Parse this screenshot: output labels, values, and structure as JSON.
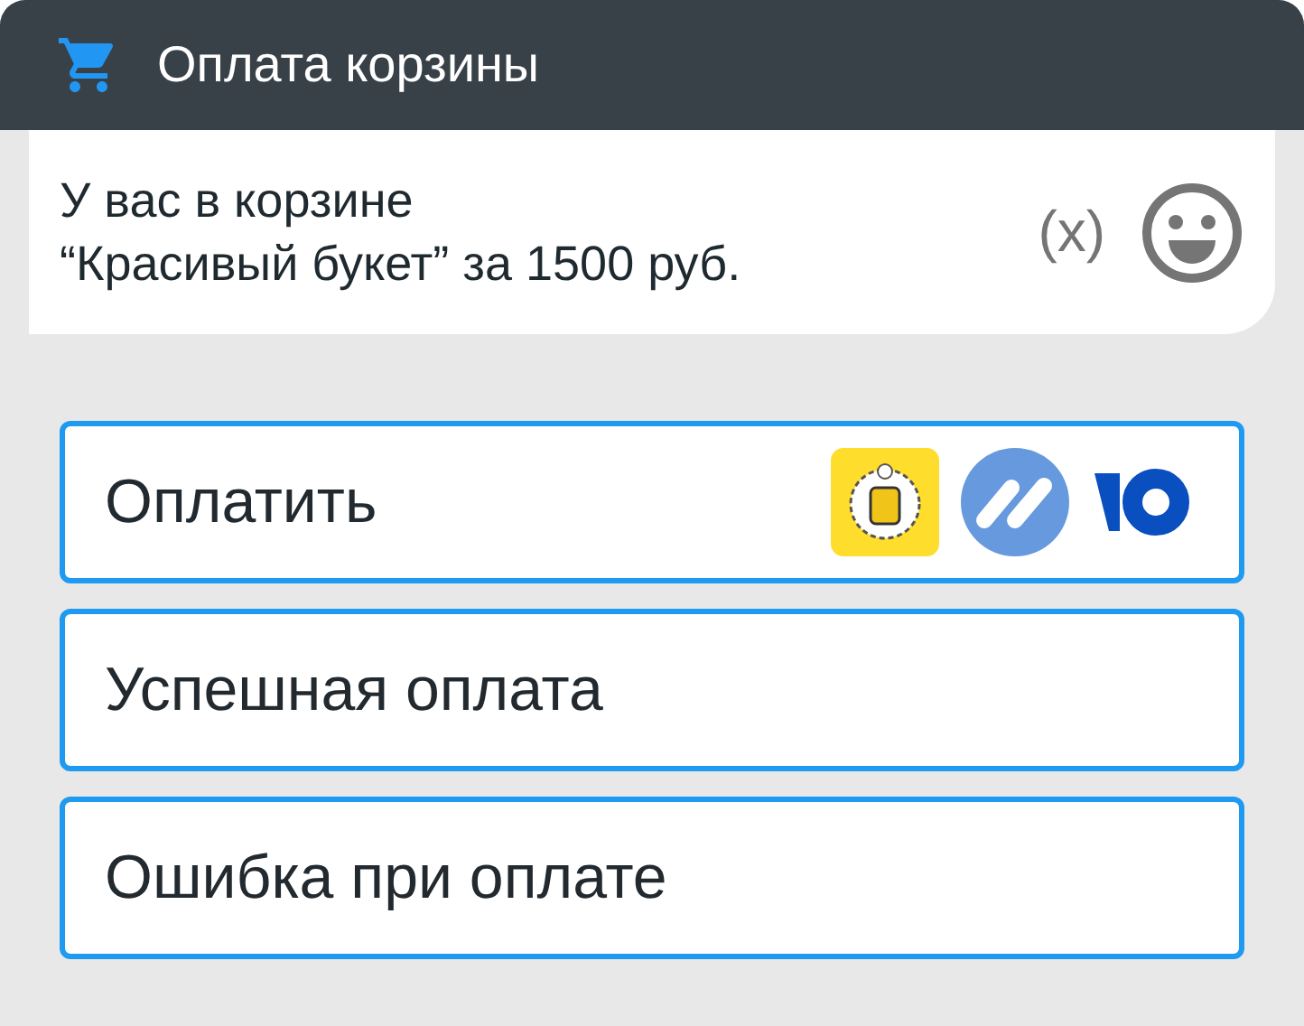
{
  "header": {
    "title": "Оплата корзины"
  },
  "message": {
    "lines": [
      "У вас в корзине",
      "“Красивый букет” за 1500 руб."
    ],
    "variable_marker": "(x)"
  },
  "buttons": [
    {
      "label": "Оплатить",
      "kind": "payment"
    },
    {
      "label": "Успешная оплата",
      "kind": "plain"
    },
    {
      "label": "Ошибка при оплате",
      "kind": "plain"
    }
  ]
}
